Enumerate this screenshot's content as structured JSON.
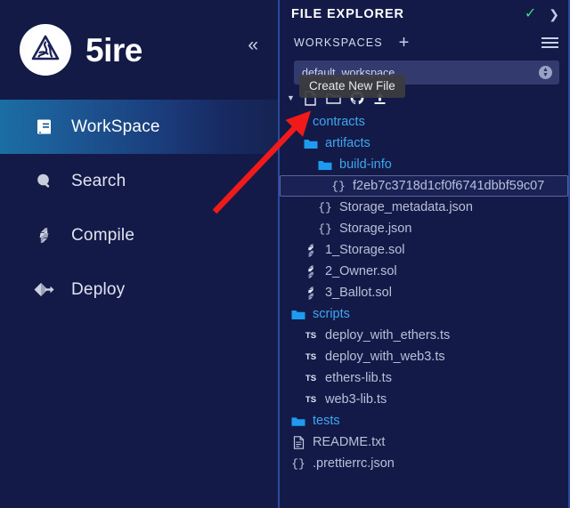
{
  "sidebar": {
    "brand": "5ire",
    "logo_icon": "5ire-logo-icon",
    "collapse_icon": "chevron-double-left-icon",
    "items": [
      {
        "label": "WorkSpace",
        "icon": "workspace-book-icon",
        "active": true
      },
      {
        "label": "Search",
        "icon": "search-icon",
        "active": false
      },
      {
        "label": "Compile",
        "icon": "solidity-compile-icon",
        "active": false
      },
      {
        "label": "Deploy",
        "icon": "deploy-ethereum-icon",
        "active": false
      }
    ],
    "accent_active_from": "#1b6ea4",
    "accent_active_to": "#152351",
    "bg": "#141a47"
  },
  "explorer": {
    "title": "FILE EXPLORER",
    "check_icon": "check-icon",
    "chevron_icon": "chevron-right-icon",
    "check_color": "#3ddc8a",
    "workspaces_label": "WORKSPACES",
    "add_icon": "plus-icon",
    "menu_icon": "hamburger-menu-icon",
    "workspace_select_value": "default_workspace",
    "select_icon": "updown-spinner-icon",
    "toolbar": {
      "collapse_icon": "caret-down-icon",
      "new_file_icon": "new-file-icon",
      "new_folder_icon": "new-folder-icon",
      "github_icon": "github-icon",
      "upload_icon": "upload-icon"
    },
    "tooltip": "Create New File",
    "folder_color": "#3ea7ef",
    "file_color": "#b9c0d8",
    "bg": "#131a48"
  },
  "tree": [
    {
      "name": "contracts",
      "type": "folder",
      "icon": "folder-open-icon",
      "depth": 1,
      "selected": false
    },
    {
      "name": "artifacts",
      "type": "folder",
      "icon": "folder-open-icon",
      "depth": 2,
      "selected": false
    },
    {
      "name": "build-info",
      "type": "folder",
      "icon": "folder-open-icon",
      "depth": 3,
      "selected": false
    },
    {
      "name": "f2eb7c3718d1cf0f6741dbbf59c07",
      "type": "file",
      "icon": "json-file-icon",
      "depth": 4,
      "selected": true
    },
    {
      "name": "Storage_metadata.json",
      "type": "file",
      "icon": "json-file-icon",
      "depth": 3,
      "selected": false
    },
    {
      "name": "Storage.json",
      "type": "file",
      "icon": "json-file-icon",
      "depth": 3,
      "selected": false
    },
    {
      "name": "1_Storage.sol",
      "type": "file",
      "icon": "solidity-file-icon",
      "depth": 2,
      "selected": false
    },
    {
      "name": "2_Owner.sol",
      "type": "file",
      "icon": "solidity-file-icon",
      "depth": 2,
      "selected": false
    },
    {
      "name": "3_Ballot.sol",
      "type": "file",
      "icon": "solidity-file-icon",
      "depth": 2,
      "selected": false
    },
    {
      "name": "scripts",
      "type": "folder",
      "icon": "folder-open-icon",
      "depth": 1,
      "selected": false
    },
    {
      "name": "deploy_with_ethers.ts",
      "type": "file",
      "icon": "typescript-file-icon",
      "depth": 2,
      "selected": false
    },
    {
      "name": "deploy_with_web3.ts",
      "type": "file",
      "icon": "typescript-file-icon",
      "depth": 2,
      "selected": false
    },
    {
      "name": "ethers-lib.ts",
      "type": "file",
      "icon": "typescript-file-icon",
      "depth": 2,
      "selected": false
    },
    {
      "name": "web3-lib.ts",
      "type": "file",
      "icon": "typescript-file-icon",
      "depth": 2,
      "selected": false
    },
    {
      "name": "tests",
      "type": "folder",
      "icon": "folder-closed-icon",
      "depth": 1,
      "selected": false
    },
    {
      "name": "README.txt",
      "type": "file",
      "icon": "text-file-icon",
      "depth": 1,
      "selected": false
    },
    {
      "name": ".prettierrc.json",
      "type": "file",
      "icon": "json-file-icon",
      "depth": 1,
      "selected": false
    }
  ],
  "annotation": {
    "arrow_icon": "red-pointer-arrow-icon",
    "color": "#f01a1a"
  }
}
